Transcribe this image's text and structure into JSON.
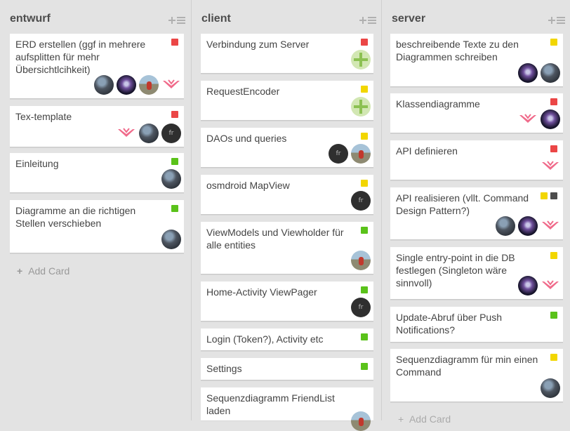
{
  "colors": {
    "red": "#eb4646",
    "yellow": "#f2d600",
    "green": "#5ac21a",
    "dark": "#4d4d4d"
  },
  "lists": [
    {
      "title": "entwurf",
      "add_card": "Add Card",
      "cards": [
        {
          "text": "ERD erstellen (ggf in mehrere aufsplitten für mehr Übersichtlcihkeit)",
          "labels": [
            "red"
          ],
          "members": [
            "photo1",
            "photo2",
            "photo3",
            "chevron"
          ]
        },
        {
          "text": "Tex-template",
          "labels": [
            "red"
          ],
          "members": [
            "chevron",
            "photo1",
            "dark"
          ]
        },
        {
          "text": "Einleitung",
          "labels": [
            "green"
          ],
          "members": [
            "photo1"
          ]
        },
        {
          "text": "Diagramme an die richtigen Stellen verschieben",
          "labels": [
            "green"
          ],
          "members": [
            "photo1"
          ]
        }
      ]
    },
    {
      "title": "client",
      "cards": [
        {
          "text": "Verbindung zum Server",
          "labels": [
            "red"
          ],
          "members": [
            "green"
          ]
        },
        {
          "text": "RequestEncoder",
          "labels": [
            "yellow"
          ],
          "members": [
            "green"
          ]
        },
        {
          "text": "DAOs und queries",
          "labels": [
            "yellow"
          ],
          "members": [
            "dark",
            "photo3"
          ]
        },
        {
          "text": "osmdroid MapView",
          "labels": [
            "yellow"
          ],
          "members": [
            "dark"
          ]
        },
        {
          "text": "ViewModels und Viewholder für alle entities",
          "labels": [
            "green"
          ],
          "members": [
            "photo3"
          ]
        },
        {
          "text": "Home-Activity ViewPager",
          "labels": [
            "green"
          ],
          "members": [
            "dark"
          ]
        },
        {
          "text": "Login (Token?), Activity etc",
          "labels": [
            "green"
          ],
          "members": []
        },
        {
          "text": "Settings",
          "labels": [
            "green"
          ],
          "members": []
        },
        {
          "text": "Sequenzdiagramm FriendList laden",
          "labels": [],
          "members": [
            "photo3"
          ]
        }
      ]
    },
    {
      "title": "server",
      "add_card": "Add Card",
      "cards": [
        {
          "text": "beschreibende Texte zu den Diagrammen schreiben",
          "labels": [
            "yellow"
          ],
          "members": [
            "photo2",
            "photo1"
          ]
        },
        {
          "text": "Klassendiagramme",
          "labels": [
            "red"
          ],
          "members": [
            "chevron",
            "photo2"
          ]
        },
        {
          "text": "API definieren",
          "labels": [
            "red"
          ],
          "members": [
            "chevron"
          ]
        },
        {
          "text": "API realisieren (vllt. Command Design Pattern?)",
          "labels": [
            "yellow",
            "dark"
          ],
          "members": [
            "photo1",
            "photo2",
            "chevron"
          ]
        },
        {
          "text": "Single entry-point in die DB festlegen (Singleton wäre sinnvoll)",
          "labels": [
            "yellow"
          ],
          "members": [
            "photo2",
            "chevron"
          ]
        },
        {
          "text": "Update-Abruf über Push Notifications?",
          "labels": [
            "green"
          ],
          "members": []
        },
        {
          "text": "Sequenzdiagramm für min einen Command",
          "labels": [
            "yellow"
          ],
          "members": [
            "photo1"
          ]
        }
      ]
    }
  ],
  "avatar_dark_initials": "fr",
  "icons": {
    "list_menu": "list-add-icon",
    "add": "plus-icon",
    "member_chevron": "chevron-logo-icon",
    "member_plus": "plus-badge-icon"
  }
}
